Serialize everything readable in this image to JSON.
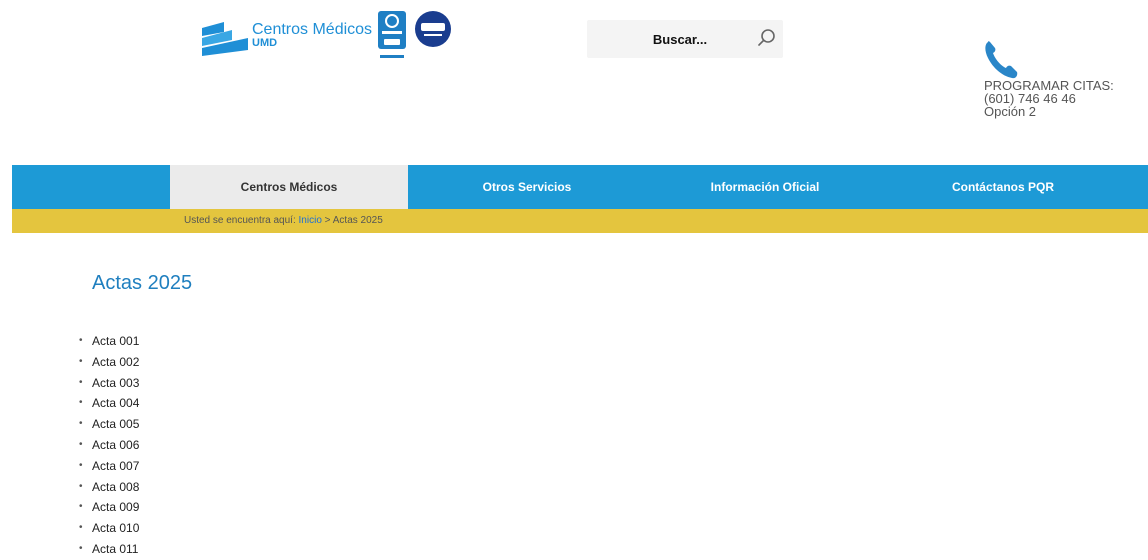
{
  "header": {
    "logo_name": "Centros Médicos",
    "logo_sub": "UMD",
    "certifications": [
      "icontec ISO 9001",
      "IQNET"
    ],
    "search_placeholder": "Buscar...",
    "contact": {
      "line1": "PROGRAMAR CITAS:",
      "line2": "(601) 746 46 46",
      "line3": "Opción 2"
    },
    "colors": {
      "brand_blue": "#1d9ad6",
      "breadcrumb_yellow": "#e4c53e"
    }
  },
  "nav": {
    "items": [
      {
        "label": "Centros Médicos",
        "active": true
      },
      {
        "label": "Otros Servicios",
        "active": false
      },
      {
        "label": "Información Oficial",
        "active": false
      },
      {
        "label": "Contáctanos PQR",
        "active": false
      }
    ]
  },
  "breadcrumb": {
    "prefix": "Usted se encuentra aquí:",
    "home": "Inicio",
    "separator": ">",
    "current": "Actas 2025"
  },
  "main": {
    "title": "Actas 2025",
    "actas": [
      "Acta 001",
      "Acta 002",
      "Acta 003",
      "Acta 004",
      "Acta 005",
      "Acta 006",
      "Acta 007",
      "Acta 008",
      "Acta 009",
      "Acta 010",
      "Acta 011"
    ]
  }
}
